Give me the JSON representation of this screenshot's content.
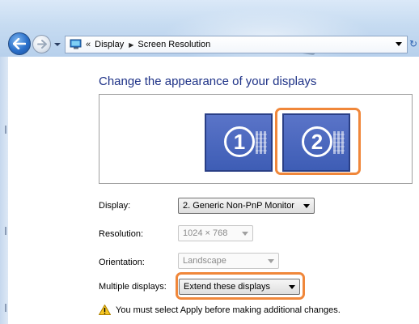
{
  "address_bar": {
    "overflow_chevron": "«",
    "crumbs": [
      "Display",
      "Screen Resolution"
    ]
  },
  "page": {
    "title": "Change the appearance of your displays"
  },
  "monitors": [
    {
      "label": "1",
      "selected": false
    },
    {
      "label": "2",
      "selected": true
    }
  ],
  "settings": {
    "display": {
      "label": "Display:",
      "value": "2. Generic Non-PnP Monitor"
    },
    "resolution": {
      "label": "Resolution:",
      "value": "1024 × 768"
    },
    "orientation": {
      "label": "Orientation:",
      "value": "Landscape"
    },
    "multiple_displays": {
      "label": "Multiple displays:",
      "value": "Extend these displays"
    }
  },
  "warning": {
    "text": "You must select Apply before making additional changes."
  },
  "colors": {
    "title_blue": "#1e3287",
    "highlight_orange": "#f0873a",
    "monitor_blue": "#3e5db5"
  }
}
